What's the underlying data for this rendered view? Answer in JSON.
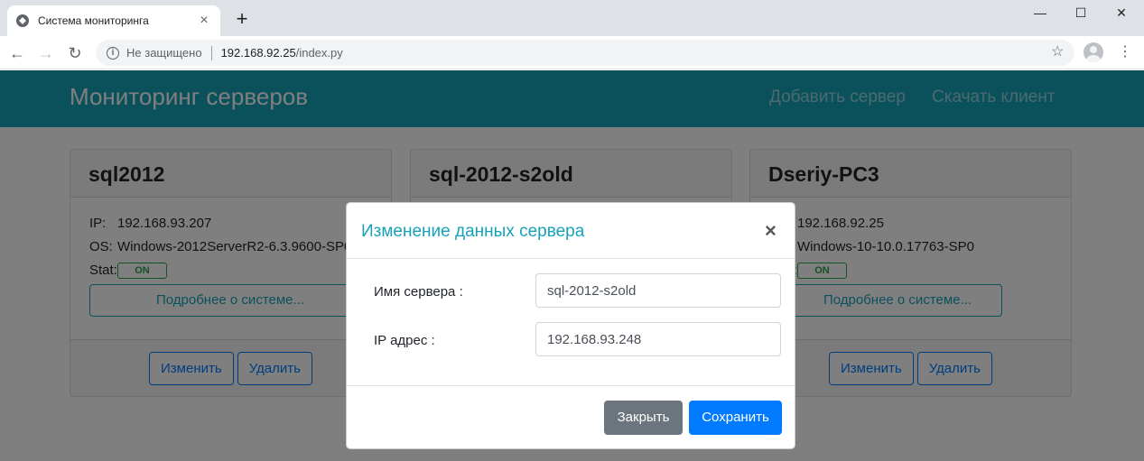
{
  "browser": {
    "tab_title": "Система мониторинга",
    "security_label": "Не защищено",
    "url_host": "192.168.92.25",
    "url_path": "/index.py"
  },
  "app": {
    "brand": "Мониторинг серверов",
    "nav_links": [
      "Добавить сервер",
      "Скачать клиент"
    ]
  },
  "labels": {
    "ip": "IP:",
    "os": "OS:",
    "stat": "Stat:",
    "details": "Подробнее о системе...",
    "edit": "Изменить",
    "delete": "Удалить"
  },
  "servers": [
    {
      "name": "sql2012",
      "ip": "192.168.93.207",
      "os": "Windows-2012ServerR2-6.3.9600-SP0",
      "status": "ON"
    },
    {
      "name": "sql-2012-s2old",
      "ip": "",
      "os": "",
      "status": ""
    },
    {
      "name": "Dseriy-PC3",
      "ip": "192.168.92.25",
      "os": "Windows-10-10.0.17763-SP0",
      "status": "ON"
    }
  ],
  "colors": {
    "accent": "#17a2b8",
    "primary": "#007bff",
    "secondary": "#6c757d",
    "success": "#28a745"
  },
  "modal": {
    "title": "Изменение данных сервера",
    "name_label": "Имя сервера :",
    "name_value": "sql-2012-s2old",
    "ip_label": "IP адрес :",
    "ip_value": "192.168.93.248",
    "close_label": "Закрыть",
    "save_label": "Сохранить"
  }
}
